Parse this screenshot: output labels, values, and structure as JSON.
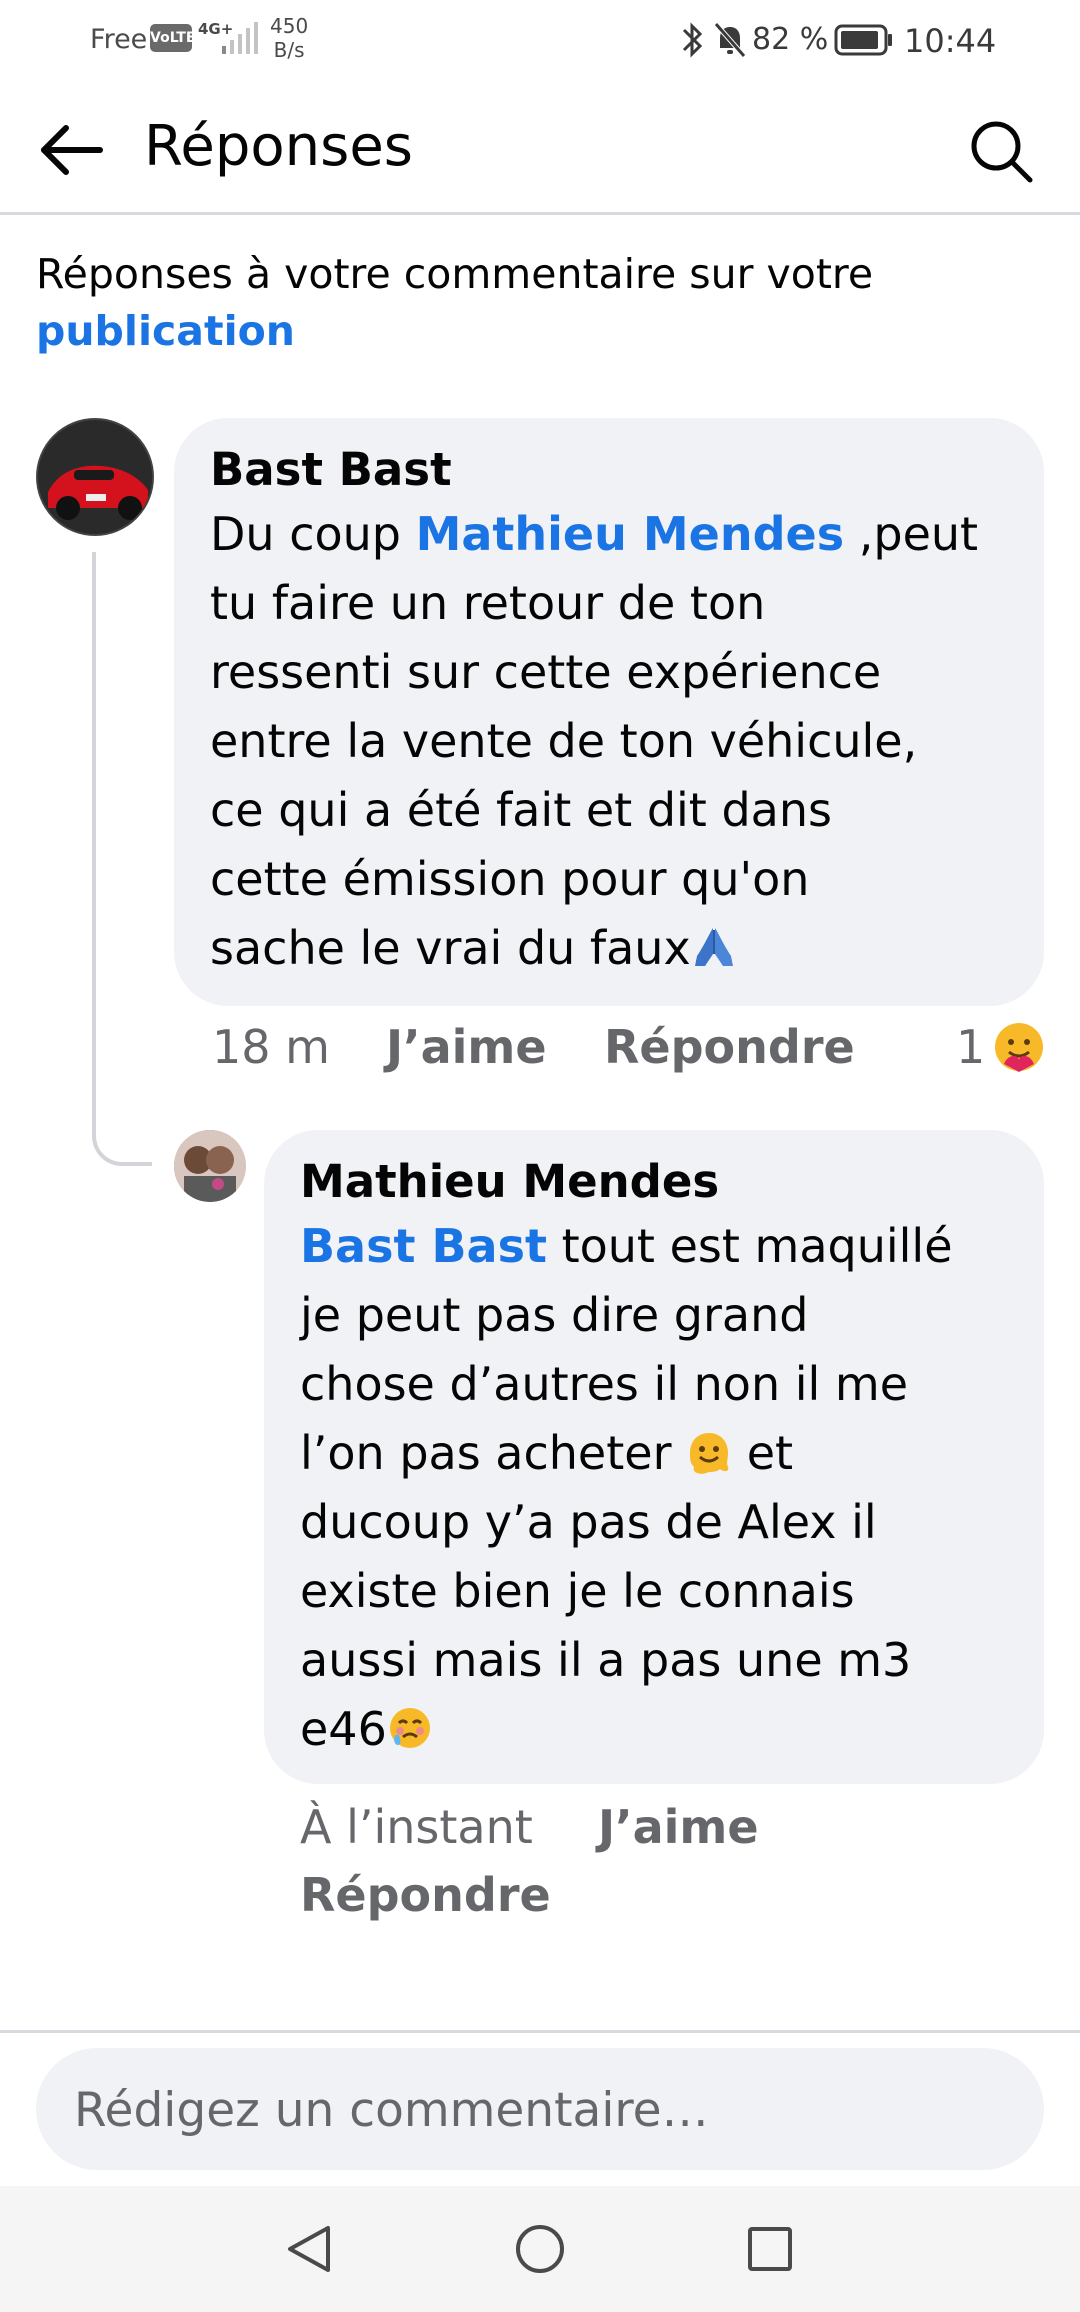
{
  "status_bar": {
    "carrier": "Free",
    "volte": "VoLTE",
    "network": "4G+",
    "speed_value": "450",
    "speed_unit": "B/s",
    "battery": "82 %",
    "time": "10:44"
  },
  "header": {
    "title": "Réponses"
  },
  "subtitle": {
    "text": "Réponses à votre commentaire sur votre",
    "link": "publication"
  },
  "comments": [
    {
      "author": "Bast Bast",
      "mention": "Mathieu Mendes",
      "lines_after_mention": " ,peut",
      "lines": [
        "tu faire un retour de ton",
        "ressenti sur cette expérience",
        "entre la vente de ton véhicule,",
        "ce qui a été fait et dit dans",
        "cette émission pour qu'on",
        "sache le vrai du faux"
      ],
      "line_prefix": "Du coup ",
      "trailing_emoji": "folded-hands-emoji",
      "time": "18 m",
      "like_label": "J’aime",
      "reply_label": "Répondre",
      "reaction_count": "1",
      "reaction_emoji": "care-emoji"
    },
    {
      "author": "Mathieu Mendes",
      "mention": "Bast Bast",
      "first_line_after_mention": " tout est maquillé",
      "lines": [
        "je peut pas dire grand",
        "chose d’autres il non il me",
        "l’on pas acheter",
        "et",
        "ducoup y’a pas de Alex il",
        "existe bien je le connais",
        "aussi mais il a pas une m3",
        "e46"
      ],
      "inline_emoji": "melting-face-emoji",
      "trailing_emoji": "face-holding-back-tears-emoji",
      "time": "À l’instant",
      "like_label": "J’aime",
      "reply_label": "Répondre"
    }
  ],
  "composer": {
    "placeholder": "Rédigez un commentaire…"
  },
  "colors": {
    "link": "#1b74e4",
    "bubble": "#f0f2f5",
    "meta": "#65676b"
  }
}
